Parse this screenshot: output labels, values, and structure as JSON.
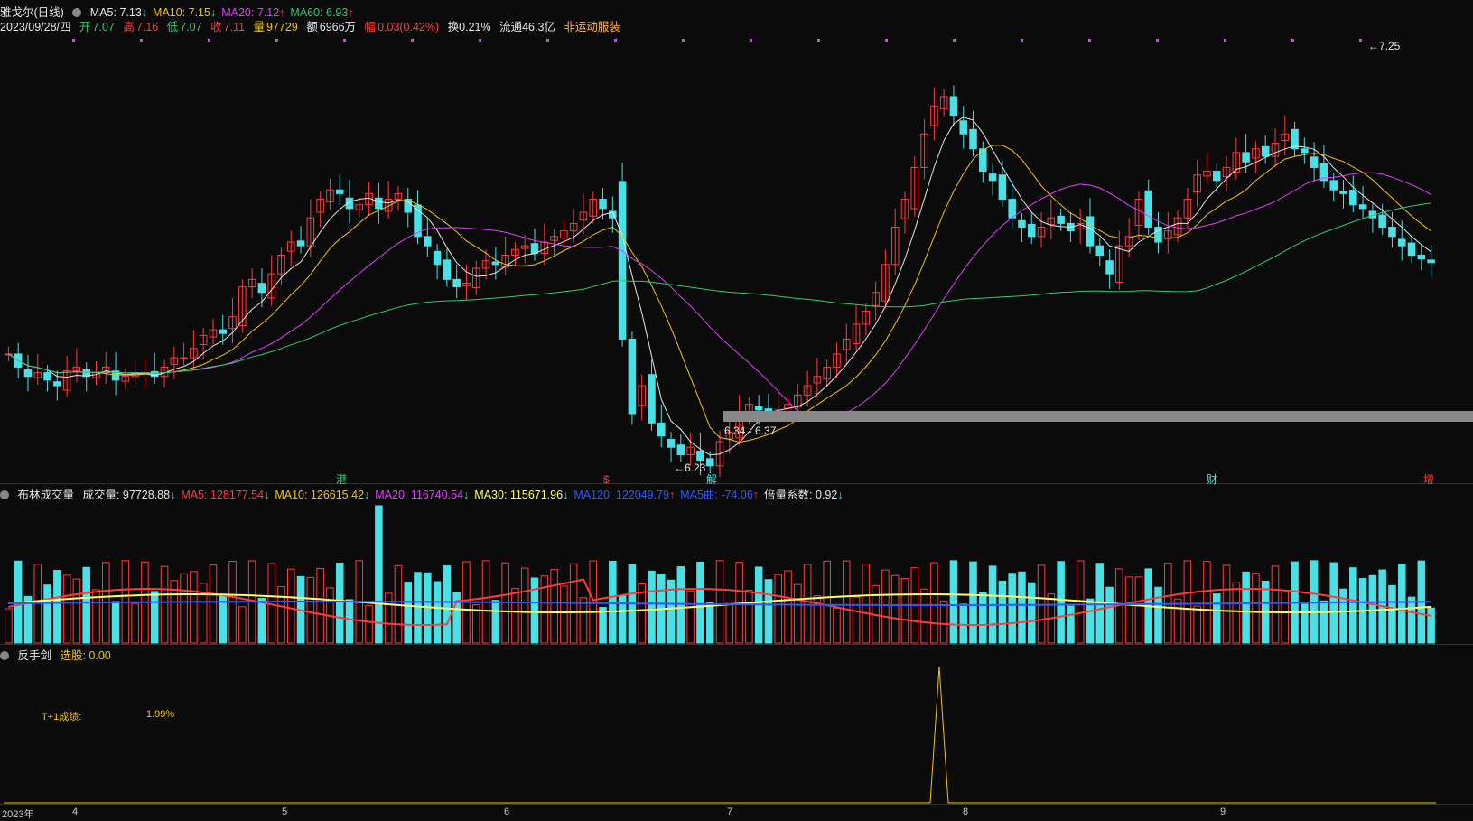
{
  "price_panel": {
    "title": "雅戈尔(日线)",
    "ma": [
      {
        "label": "MA5: 7.13",
        "arrow": "↓",
        "color": "#e6e6e6"
      },
      {
        "label": "MA10: 7.15",
        "arrow": "↓",
        "color": "#f1c40f"
      },
      {
        "label": "MA20: 7.12",
        "arrow": "↑",
        "color": "#e040fb"
      },
      {
        "label": "MA60: 6.93",
        "arrow": "↑",
        "color": "#2ecc71"
      }
    ],
    "info": {
      "date": "2023/09/28/四",
      "open_label": "开",
      "open": "7.07",
      "high_label": "高",
      "high": "7.16",
      "low_label": "低",
      "low": "7.07",
      "close_label": "收",
      "close": "7.11",
      "vol_label": "量",
      "vol": "97729",
      "amt_label": "额",
      "amt": "6966万",
      "chg_label": "幅",
      "chg": "0.03(0.42%)",
      "turnover": "换0.21%",
      "float": "流通46.3亿",
      "tag": "非运动服装"
    },
    "annotations": {
      "high": "7.25",
      "low": "6.23",
      "band": "6.34 - 6.37"
    },
    "event_markers": [
      {
        "label": "港",
        "color": "#2ecc71"
      },
      {
        "label": "$",
        "color": "#ff3b3b"
      },
      {
        "label": "解",
        "color": "#49e0e6"
      },
      {
        "label": "财",
        "color": "#49e0e6"
      },
      {
        "label": "增",
        "color": "#ff3b3b"
      }
    ]
  },
  "volume_panel": {
    "title": "布林成交量",
    "items": [
      {
        "label": "成交量: 97728.88",
        "arrow": "↓",
        "color": "#e6e6e6"
      },
      {
        "label": "MA5: 128177.54",
        "arrow": "↓",
        "color": "#ff3b3b"
      },
      {
        "label": "MA10: 126615.42",
        "arrow": "↓",
        "color": "#f1c40f"
      },
      {
        "label": "MA20: 116740.54",
        "arrow": "↓",
        "color": "#e040fb"
      },
      {
        "label": "MA30: 115671.96",
        "arrow": "↓",
        "color": "#ffff66"
      },
      {
        "label": "MA120: 122049.79",
        "arrow": "↑",
        "color": "#2b59ff"
      },
      {
        "label": "MA5曲: -74.06",
        "arrow": "↑",
        "color": "#2b59ff"
      },
      {
        "label": "倍量系数: 0.92",
        "arrow": "↓",
        "color": "#e6e6e6"
      }
    ]
  },
  "indicator_panel": {
    "title": "反手剑",
    "item": "选股: 0.00",
    "t1_label": "T+1成绩:",
    "t1_value": "1.99%"
  },
  "x_axis": {
    "year": "2023年",
    "months": [
      "4",
      "5",
      "6",
      "7",
      "8",
      "9"
    ]
  },
  "chart_data": {
    "type": "candlestick",
    "title": "雅戈尔(日线)",
    "period": "2023-03 to 2023-09-28",
    "close": [
      6.62,
      6.55,
      6.5,
      6.52,
      6.48,
      6.45,
      6.53,
      6.55,
      6.5,
      6.52,
      6.55,
      6.48,
      6.5,
      6.52,
      6.52,
      6.5,
      6.55,
      6.6,
      6.6,
      6.65,
      6.72,
      6.75,
      6.73,
      6.82,
      6.98,
      7.02,
      6.95,
      7.05,
      7.15,
      7.22,
      7.2,
      7.35,
      7.45,
      7.5,
      7.48,
      7.4,
      7.42,
      7.48,
      7.4,
      7.45,
      7.48,
      7.38,
      7.25,
      7.2,
      7.1,
      7.02,
      6.98,
      7.0,
      7.08,
      7.12,
      7.1,
      7.15,
      7.18,
      7.2,
      7.16,
      7.22,
      7.25,
      7.28,
      7.32,
      7.38,
      7.45,
      7.4,
      7.35,
      6.7,
      6.3,
      6.45,
      6.25,
      6.18,
      6.12,
      6.08,
      6.12,
      6.05,
      6.02,
      6.15,
      6.2,
      6.3,
      6.35,
      6.32,
      6.3,
      6.32,
      6.35,
      6.4,
      6.45,
      6.5,
      6.55,
      6.62,
      6.7,
      6.78,
      6.85,
      6.95,
      7.1,
      7.3,
      7.45,
      7.62,
      7.8,
      7.95,
      8.0,
      7.9,
      7.8,
      7.72,
      7.6,
      7.55,
      7.45,
      7.35,
      7.3,
      7.25,
      7.3,
      7.35,
      7.32,
      7.28,
      7.32,
      7.2,
      7.15,
      7.05,
      7.2,
      7.25,
      7.45,
      7.3,
      7.22,
      7.28,
      7.35,
      7.45,
      7.58,
      7.6,
      7.55,
      7.62,
      7.7,
      7.65,
      7.72,
      7.68,
      7.75,
      7.8,
      7.72,
      7.7,
      7.62,
      7.55,
      7.5,
      7.48,
      7.42,
      7.4,
      7.35,
      7.3,
      7.25,
      7.2,
      7.15,
      7.13,
      7.11
    ],
    "volume_max": 620000,
    "price_range": [
      6.0,
      8.3
    ]
  }
}
